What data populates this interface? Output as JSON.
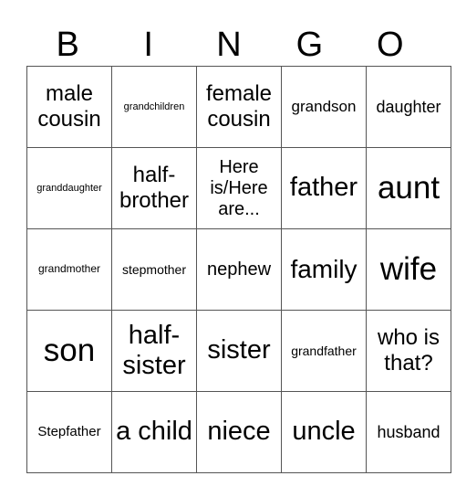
{
  "header": [
    "B",
    "I",
    "N",
    "G",
    "O"
  ],
  "cells": [
    [
      {
        "t": "male cousin",
        "s": 24
      },
      {
        "t": "grandchildren",
        "s": 11
      },
      {
        "t": "female cousin",
        "s": 24
      },
      {
        "t": "grandson",
        "s": 17
      },
      {
        "t": "daughter",
        "s": 18
      }
    ],
    [
      {
        "t": "granddaughter",
        "s": 11
      },
      {
        "t": "half-brother",
        "s": 24
      },
      {
        "t": "Here is/Here are...",
        "s": 20
      },
      {
        "t": "father",
        "s": 29
      },
      {
        "t": "aunt",
        "s": 35
      }
    ],
    [
      {
        "t": "grandmother",
        "s": 12
      },
      {
        "t": "stepmother",
        "s": 14
      },
      {
        "t": "nephew",
        "s": 20
      },
      {
        "t": "family",
        "s": 28
      },
      {
        "t": "wife",
        "s": 35
      }
    ],
    [
      {
        "t": "son",
        "s": 35
      },
      {
        "t": "half-sister",
        "s": 29
      },
      {
        "t": "sister",
        "s": 29
      },
      {
        "t": "grandfather",
        "s": 14
      },
      {
        "t": "who is that?",
        "s": 24
      }
    ],
    [
      {
        "t": "Stepfather",
        "s": 15
      },
      {
        "t": "a child",
        "s": 29
      },
      {
        "t": "niece",
        "s": 29
      },
      {
        "t": "uncle",
        "s": 29
      },
      {
        "t": "husband",
        "s": 18
      }
    ]
  ]
}
